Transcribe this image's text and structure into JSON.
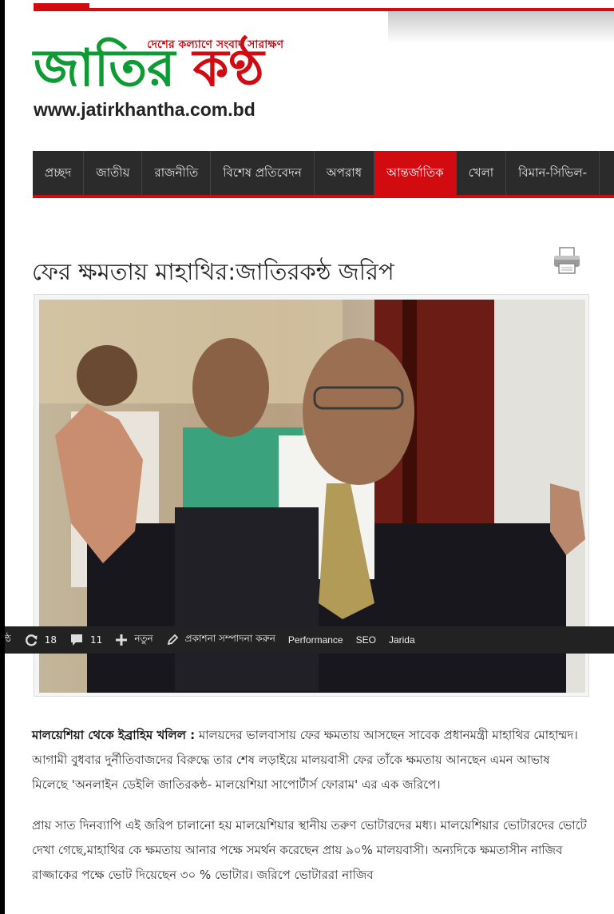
{
  "header": {
    "tagline": "দেশের কল্যাণে সংবাদ সারাক্ষণ",
    "logo_part1": "জাতির",
    "logo_part2": "কণ্ঠ",
    "url": "www.jatirkhantha.com.bd"
  },
  "nav": {
    "items": [
      "প্রচ্ছদ",
      "জাতীয়",
      "রাজনীতি",
      "বিশেষ প্রতিবেদন",
      "অপরাধ",
      "আন্তর্জাতিক",
      "খেলা",
      "বিমান-সিভিল-"
    ],
    "active_index": 5
  },
  "article": {
    "title": "ফের ক্ষমতায় মাহাথির:জাতিরকন্ঠ জরিপ",
    "byline": "মালয়েশিয়া থেকে ইব্রাহিম খলিল :",
    "para1": " মালয়দের ভালবাসায় ফের ক্ষমতায় আসছেন সাবেক প্রধানমন্ত্রী মাহাথির মোহাম্মদ। আগামী বুধবার দুর্নীতিবাজদের বিরুদ্ধে তার শেষ লড়াইয়ে মালয়বাসী ফের তাঁকে ক্ষমতায় আনছেন এমন আভাষ মিলেছে 'অনলাইন ডেইলি জাতিরকন্ঠ- মালয়েশিয়া সাপোর্টার্স ফোরাম' এর এক জরিপে।",
    "para2": "প্রায় সাত দিনব্যাপি এই জরিপ চালানো হয় মালয়েশিয়ার স্থানীয় তরুণ ভোটারদের মধ্য। মালয়েশিয়ার ভোটারদের ভোটে দেখা গেছে,মাহাথির কে ক্ষমতায় আনার পক্ষে সমর্থন করেছেন প্রায় ৯০% মালয়বাসী। অন্যদিকে ক্ষমতাসীন নাজিব রাজ্জাকের পক্ষে ভোট দিয়েছেন ৩০ % ভোটার। জরিপে ভোটাররা নাজিব"
  },
  "adminbar": {
    "site_fragment": "ন্ঠ",
    "updates_count": "18",
    "comments_count": "11",
    "new_label": "নতুন",
    "edit_label": "প্রকাশনা সম্পাদনা করুন",
    "performance_label": "Performance",
    "seo_label": "SEO",
    "theme_label": "Jarida"
  },
  "colors": {
    "brand_red": "#d10b10",
    "brand_green": "#0f9b34",
    "nav_bg": "#2b2b2b",
    "adminbar_bg": "#222222"
  },
  "icons": [
    "print-icon",
    "refresh-icon",
    "comment-icon",
    "plus-icon",
    "pencil-icon"
  ]
}
